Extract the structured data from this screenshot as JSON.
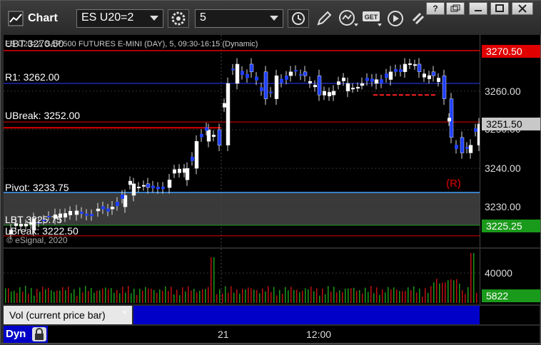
{
  "app": {
    "title": "Chart"
  },
  "toolbar": {
    "symbol": "ES U20=2",
    "interval": "5",
    "icons": [
      "settings-gear-icon",
      "clock-icon",
      "pencil-icon",
      "study-icon",
      "get-icon",
      "play-icon",
      "link-icon"
    ],
    "window_controls": [
      "?",
      "restore",
      "minimize",
      "maximize",
      "close"
    ]
  },
  "chart": {
    "header": "ES U20=2, S&P 500 FUTURES E-MINI (DAY), 5, 09:30-16:15 (Dynamic)",
    "header_overlap": "UBT 3270.50",
    "levels": [
      {
        "label": "R1: 3262.00"
      },
      {
        "label": "UBreak: 3252.00"
      },
      {
        "label": "Pivot: 3233.75"
      },
      {
        "label": "LBT 3225.75"
      },
      {
        "label": "LBreak: 3222.50"
      }
    ],
    "copyright": "© eSignal, 2020",
    "marker": "(R)",
    "y_axis_labels": [
      "3260.00",
      "3250.00",
      "3240.00",
      "3230.00"
    ],
    "price_tags": [
      {
        "text": "3270.50",
        "color": "#e00000",
        "text_color": "#ffffff"
      },
      {
        "text": "3251.50",
        "color": "#c8c8c8",
        "text_color": "#000000"
      },
      {
        "text": "3225.25",
        "color": "#1a9a1a",
        "text_color": "#ffffff"
      }
    ]
  },
  "volume": {
    "label": "Vol (current price bar)",
    "close": "×",
    "axis_label": "40000",
    "tag": "5822"
  },
  "time_axis": {
    "labels": [
      "21",
      "12:00"
    ],
    "dyn": "Dyn"
  }
}
